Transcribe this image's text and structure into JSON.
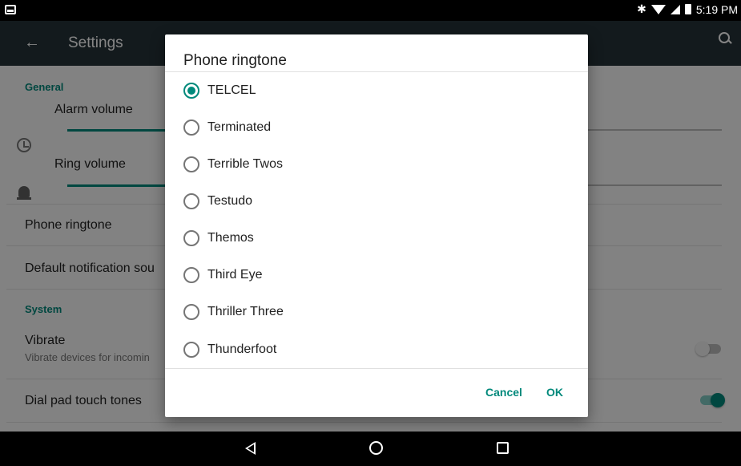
{
  "status_bar": {
    "time": "5:19 PM",
    "icons": [
      "screenshot-icon",
      "bluetooth-icon",
      "wifi-icon",
      "signal-icon",
      "battery-icon"
    ]
  },
  "toolbar": {
    "title": "Settings",
    "back_icon": "arrow-back-icon",
    "search_icon": "search-icon"
  },
  "settings": {
    "general_header": "General",
    "alarm_volume_label": "Alarm volume",
    "alarm_volume_level": 0.4,
    "ring_volume_label": "Ring volume",
    "ring_volume_level": 0.4,
    "phone_ringtone_label": "Phone ringtone",
    "default_notification_label": "Default notification sou",
    "system_header": "System",
    "vibrate_label": "Vibrate",
    "vibrate_sub": "Vibrate devices for incomin",
    "vibrate_enabled": false,
    "dial_pad_label": "Dial pad touch tones",
    "dial_pad_enabled": true
  },
  "dialog": {
    "title": "Phone ringtone",
    "options": [
      {
        "label": "TELCEL",
        "checked": true
      },
      {
        "label": "Terminated",
        "checked": false
      },
      {
        "label": "Terrible Twos",
        "checked": false
      },
      {
        "label": "Testudo",
        "checked": false
      },
      {
        "label": "Themos",
        "checked": false
      },
      {
        "label": "Third Eye",
        "checked": false
      },
      {
        "label": "Thriller Three",
        "checked": false
      },
      {
        "label": "Thunderfoot",
        "checked": false
      }
    ],
    "cancel_label": "Cancel",
    "ok_label": "OK"
  },
  "colors": {
    "accent": "#00897b",
    "toolbar": "#263238"
  },
  "navbar": {
    "icons": [
      "back-nav-icon",
      "home-nav-icon",
      "recents-nav-icon"
    ]
  }
}
